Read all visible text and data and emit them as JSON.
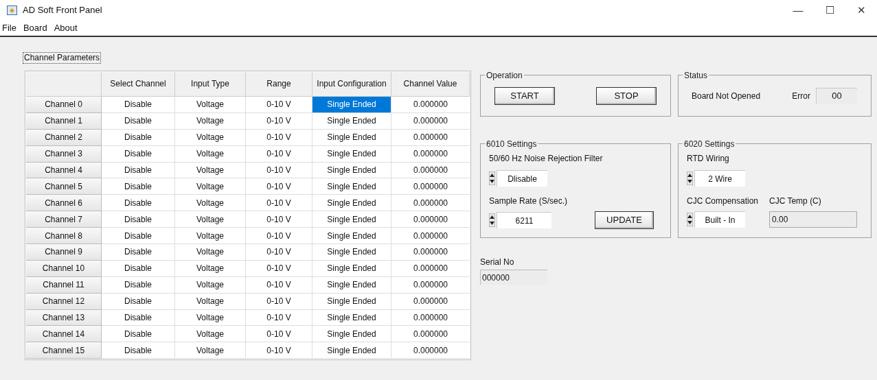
{
  "window": {
    "title": "AD Soft Front Panel",
    "controls": [
      "—",
      "☐",
      "✕"
    ]
  },
  "menu": [
    "File",
    "Board",
    "About"
  ],
  "channel_parameters": {
    "label": "Channel Parameters",
    "columns": [
      "Select Channel",
      "Input Type",
      "Range",
      "Input Configuration",
      "Channel Value"
    ],
    "rows": [
      {
        "channel": "Channel 0",
        "select": "Disable",
        "type": "Voltage",
        "range": "0-10 V",
        "config": {
          "text": "Single Ended",
          "selected": true
        },
        "value": "0.000000"
      },
      {
        "channel": "Channel 1",
        "select": "Disable",
        "type": "Voltage",
        "range": "0-10 V",
        "config": {
          "text": "Single Ended",
          "selected": false
        },
        "value": "0.000000"
      },
      {
        "channel": "Channel 2",
        "select": "Disable",
        "type": "Voltage",
        "range": "0-10 V",
        "config": {
          "text": "Single Ended",
          "selected": false
        },
        "value": "0.000000"
      },
      {
        "channel": "Channel 3",
        "select": "Disable",
        "type": "Voltage",
        "range": "0-10 V",
        "config": {
          "text": "Single Ended",
          "selected": false
        },
        "value": "0.000000"
      },
      {
        "channel": "Channel 4",
        "select": "Disable",
        "type": "Voltage",
        "range": "0-10 V",
        "config": {
          "text": "Single Ended",
          "selected": false
        },
        "value": "0.000000"
      },
      {
        "channel": "Channel 5",
        "select": "Disable",
        "type": "Voltage",
        "range": "0-10 V",
        "config": {
          "text": "Single Ended",
          "selected": false
        },
        "value": "0.000000"
      },
      {
        "channel": "Channel 6",
        "select": "Disable",
        "type": "Voltage",
        "range": "0-10 V",
        "config": {
          "text": "Single Ended",
          "selected": false
        },
        "value": "0.000000"
      },
      {
        "channel": "Channel 7",
        "select": "Disable",
        "type": "Voltage",
        "range": "0-10 V",
        "config": {
          "text": "Single Ended",
          "selected": false
        },
        "value": "0.000000"
      },
      {
        "channel": "Channel 8",
        "select": "Disable",
        "type": "Voltage",
        "range": "0-10 V",
        "config": {
          "text": "Single Ended",
          "selected": false
        },
        "value": "0.000000"
      },
      {
        "channel": "Channel 9",
        "select": "Disable",
        "type": "Voltage",
        "range": "0-10 V",
        "config": {
          "text": "Single Ended",
          "selected": false
        },
        "value": "0.000000"
      },
      {
        "channel": "Channel 10",
        "select": "Disable",
        "type": "Voltage",
        "range": "0-10 V",
        "config": {
          "text": "Single Ended",
          "selected": false
        },
        "value": "0.000000"
      },
      {
        "channel": "Channel 11",
        "select": "Disable",
        "type": "Voltage",
        "range": "0-10 V",
        "config": {
          "text": "Single Ended",
          "selected": false
        },
        "value": "0.000000"
      },
      {
        "channel": "Channel 12",
        "select": "Disable",
        "type": "Voltage",
        "range": "0-10 V",
        "config": {
          "text": "Single Ended",
          "selected": false
        },
        "value": "0.000000"
      },
      {
        "channel": "Channel 13",
        "select": "Disable",
        "type": "Voltage",
        "range": "0-10 V",
        "config": {
          "text": "Single Ended",
          "selected": false
        },
        "value": "0.000000"
      },
      {
        "channel": "Channel 14",
        "select": "Disable",
        "type": "Voltage",
        "range": "0-10 V",
        "config": {
          "text": "Single Ended",
          "selected": false
        },
        "value": "0.000000"
      },
      {
        "channel": "Channel 15",
        "select": "Disable",
        "type": "Voltage",
        "range": "0-10 V",
        "config": {
          "text": "Single Ended",
          "selected": false
        },
        "value": "0.000000"
      }
    ]
  },
  "operation": {
    "title": "Operation",
    "buttons": [
      "START",
      "STOP"
    ]
  },
  "status": {
    "title": "Status",
    "message": "Board Not Opened",
    "error_label": "Error",
    "error_value": "00"
  },
  "settings_6010": {
    "title": "6010 Settings",
    "filter_label": "50/60 Hz Noise Rejection Filter",
    "filter_value": "Dlisable",
    "rate_label": "Sample Rate (S/sec.)",
    "rate_value": "6211",
    "update_button": "UPDATE"
  },
  "settings_6020": {
    "title": "6020 Settings",
    "wiring_label": "RTD Wiring",
    "wiring_value": "2 Wire",
    "cjc_label": "CJC Compensation",
    "cjc_value": "Built - In",
    "temp_label": "CJC Temp (C)",
    "temp_value": "0.00"
  },
  "serial": {
    "label": "Serial No",
    "value": "000000"
  }
}
